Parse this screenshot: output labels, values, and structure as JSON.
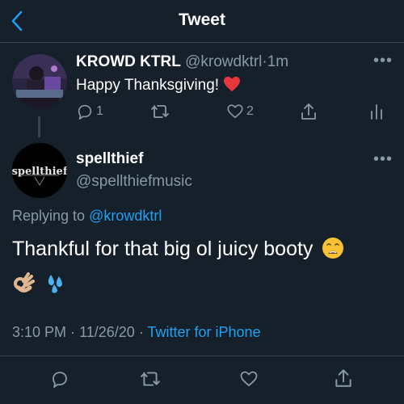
{
  "header": {
    "title": "Tweet"
  },
  "parent_tweet": {
    "display_name": "KROWD KTRL",
    "handle": "@krowdktrl",
    "separator": "·",
    "time": "1m",
    "text": "Happy Thanksgiving!",
    "reply_count": "1",
    "like_count": "2"
  },
  "main_tweet": {
    "display_name": "spellthief",
    "handle": "@spellthiefmusic",
    "avatar_text": "spellthief",
    "replying_prefix": "Replying to",
    "replying_to": "@krowdktrl",
    "text": "Thankful for that big ol juicy booty",
    "time": "3:10 PM",
    "date": "11/26/20",
    "meta_sep": "·",
    "source": "Twitter for iPhone"
  },
  "colors": {
    "background": "#15202b",
    "accent": "#1da1f2",
    "muted": "#8899a6",
    "divider": "#38444d"
  }
}
